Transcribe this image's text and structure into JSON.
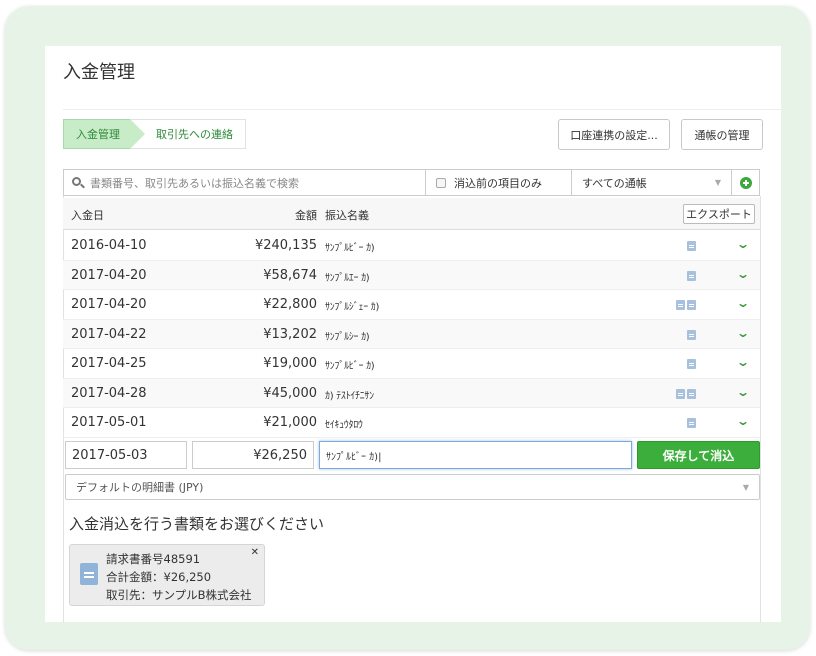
{
  "page": {
    "title": "入金管理"
  },
  "steps": [
    {
      "label": "入金管理"
    },
    {
      "label": "取引先への連絡"
    }
  ],
  "toolbar": {
    "bank_settings_label": "口座連携の設定...",
    "bankbook_label": "通帳の管理"
  },
  "search": {
    "placeholder": "書類番号、取引先あるいは振込名義で検索",
    "filter_label": "消込前の項目のみ",
    "account_select": "すべての通帳"
  },
  "table": {
    "headers": {
      "date": "入金日",
      "amount": "金額",
      "name": "振込名義"
    },
    "export_label": "エクスポート",
    "rows": [
      {
        "date": "2016-04-10",
        "amount": "¥240,135",
        "name": "ｻﾝﾌﾟﾙﾋﾞｰ ｶ)",
        "docs": 1
      },
      {
        "date": "2017-04-20",
        "amount": "¥58,674",
        "name": "ｻﾝﾌﾟﾙｴｰ ｶ)",
        "docs": 1
      },
      {
        "date": "2017-04-20",
        "amount": "¥22,800",
        "name": "ｻﾝﾌﾟﾙｼﾞｪｰ ｶ)",
        "docs": 2
      },
      {
        "date": "2017-04-22",
        "amount": "¥13,202",
        "name": "ｻﾝﾌﾟﾙｼｰ ｶ)",
        "docs": 1
      },
      {
        "date": "2017-04-25",
        "amount": "¥19,000",
        "name": "ｻﾝﾌﾟﾙﾋﾞｰ ｶ)",
        "docs": 1
      },
      {
        "date": "2017-04-28",
        "amount": "¥45,000",
        "name": "ｶ) ﾃｽﾄｲﾁﾆｻﾝ",
        "docs": 2
      },
      {
        "date": "2017-05-01",
        "amount": "¥21,000",
        "name": "ｾｲｷｭｳﾀﾛｳ",
        "docs": 1
      }
    ]
  },
  "edit_row": {
    "date": "2017-05-03",
    "amount": "¥26,250",
    "name": "ｻﾝﾌﾟﾙﾋﾞｰ ｶ)|",
    "save_label": "保存して消込"
  },
  "statement_select": "デフォルトの明細書 (JPY)",
  "choose_section": {
    "title": "入金消込を行う書類をお選びください",
    "card": {
      "line1": "請求書番号48591",
      "line2": "合計金額：¥26,250",
      "line3": "取引先：サンプルB株式会社"
    }
  },
  "colors": {
    "accent_green": "#3cae3c",
    "step_active_bg": "#c8ecc7"
  }
}
